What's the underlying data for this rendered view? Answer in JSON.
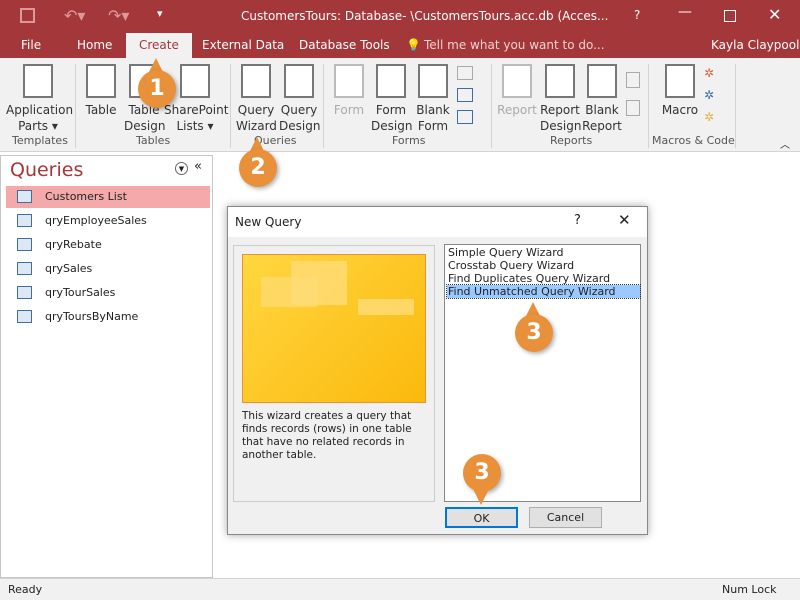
{
  "titlebar": {
    "title": "CustomersTours: Database- \\CustomersTours.acc.db (Acces...",
    "help": "?"
  },
  "tabs": [
    {
      "label": "File"
    },
    {
      "label": "Home"
    },
    {
      "label": "Create"
    },
    {
      "label": "External Data"
    },
    {
      "label": "Database Tools"
    }
  ],
  "tellme": "Tell me what you want to do...",
  "user": "Kayla Claypool",
  "ribbon": {
    "buttons": [
      {
        "l1": "Application",
        "l2": "Parts ▾"
      },
      {
        "l1": "Table",
        "l2": ""
      },
      {
        "l1": "Table",
        "l2": "Design"
      },
      {
        "l1": "SharePoint",
        "l2": "Lists ▾"
      },
      {
        "l1": "Query",
        "l2": "Wizard"
      },
      {
        "l1": "Query",
        "l2": "Design"
      },
      {
        "l1": "Form",
        "l2": ""
      },
      {
        "l1": "Form",
        "l2": "Design"
      },
      {
        "l1": "Blank",
        "l2": "Form"
      },
      {
        "l1": "Report",
        "l2": ""
      },
      {
        "l1": "Report",
        "l2": "Design"
      },
      {
        "l1": "Blank",
        "l2": "Report"
      },
      {
        "l1": "Macro",
        "l2": ""
      }
    ],
    "groups": [
      "Templates",
      "Tables",
      "Queries",
      "Forms",
      "Reports",
      "Macros & Code"
    ]
  },
  "nav": {
    "title": "Queries",
    "items": [
      "Customers List",
      "qryEmployeeSales",
      "qryRebate",
      "qrySales",
      "qryTourSales",
      "qryToursByName"
    ],
    "selected": 0
  },
  "dialog": {
    "title": "New Query",
    "help": "?",
    "description": "This wizard creates a query that finds records (rows) in one table that have no related records in another table.",
    "options": [
      "Simple Query Wizard",
      "Crosstab Query Wizard",
      "Find Duplicates Query Wizard",
      "Find Unmatched Query Wizard"
    ],
    "selected": 3,
    "ok": "OK",
    "cancel": "Cancel"
  },
  "badges": [
    "1",
    "2",
    "3",
    "3"
  ],
  "status": {
    "left": "Ready",
    "right": "Num Lock"
  },
  "colors": {
    "accent": "#a4373a",
    "badge": "#e8903a",
    "selection": "#99c9ff"
  }
}
